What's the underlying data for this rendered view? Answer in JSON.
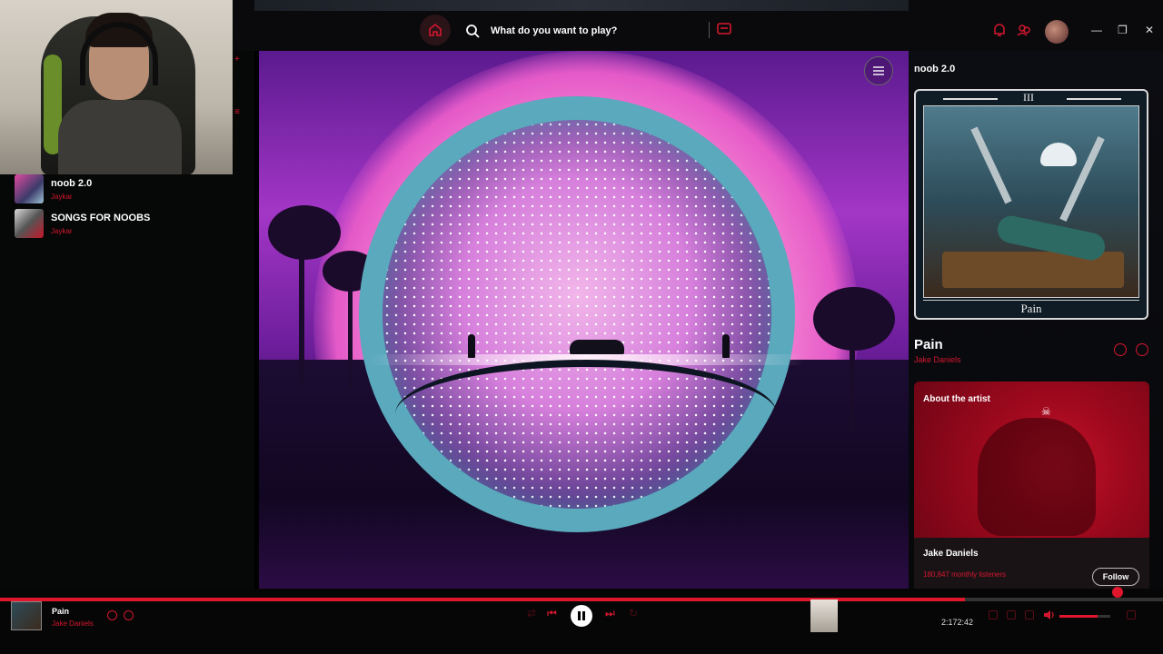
{
  "search": {
    "placeholder": "What do you want to play?"
  },
  "sidebar": {
    "playlists": [
      {
        "name": "noob 2.0",
        "owner": "Jaykar"
      },
      {
        "name": "SONGS FOR NOOBS",
        "owner": "Jaykar"
      }
    ]
  },
  "right_panel": {
    "playlist_title": "noob 2.0",
    "cover_numeral": "III",
    "cover_banner": "Pain",
    "song_title": "Pain",
    "song_artist": "Jake Daniels",
    "about": {
      "label": "About the artist",
      "artist_name": "Jake Daniels",
      "listeners": "180,847 monthly listeners",
      "follow_label": "Follow"
    }
  },
  "player": {
    "title": "Pain",
    "artist": "Jake Daniels",
    "time": "2:17",
    "time_remaining": "2:42",
    "progress": 0.83,
    "volume": 0.75
  },
  "colors": {
    "accent": "#e0162d",
    "background": "#060606"
  }
}
